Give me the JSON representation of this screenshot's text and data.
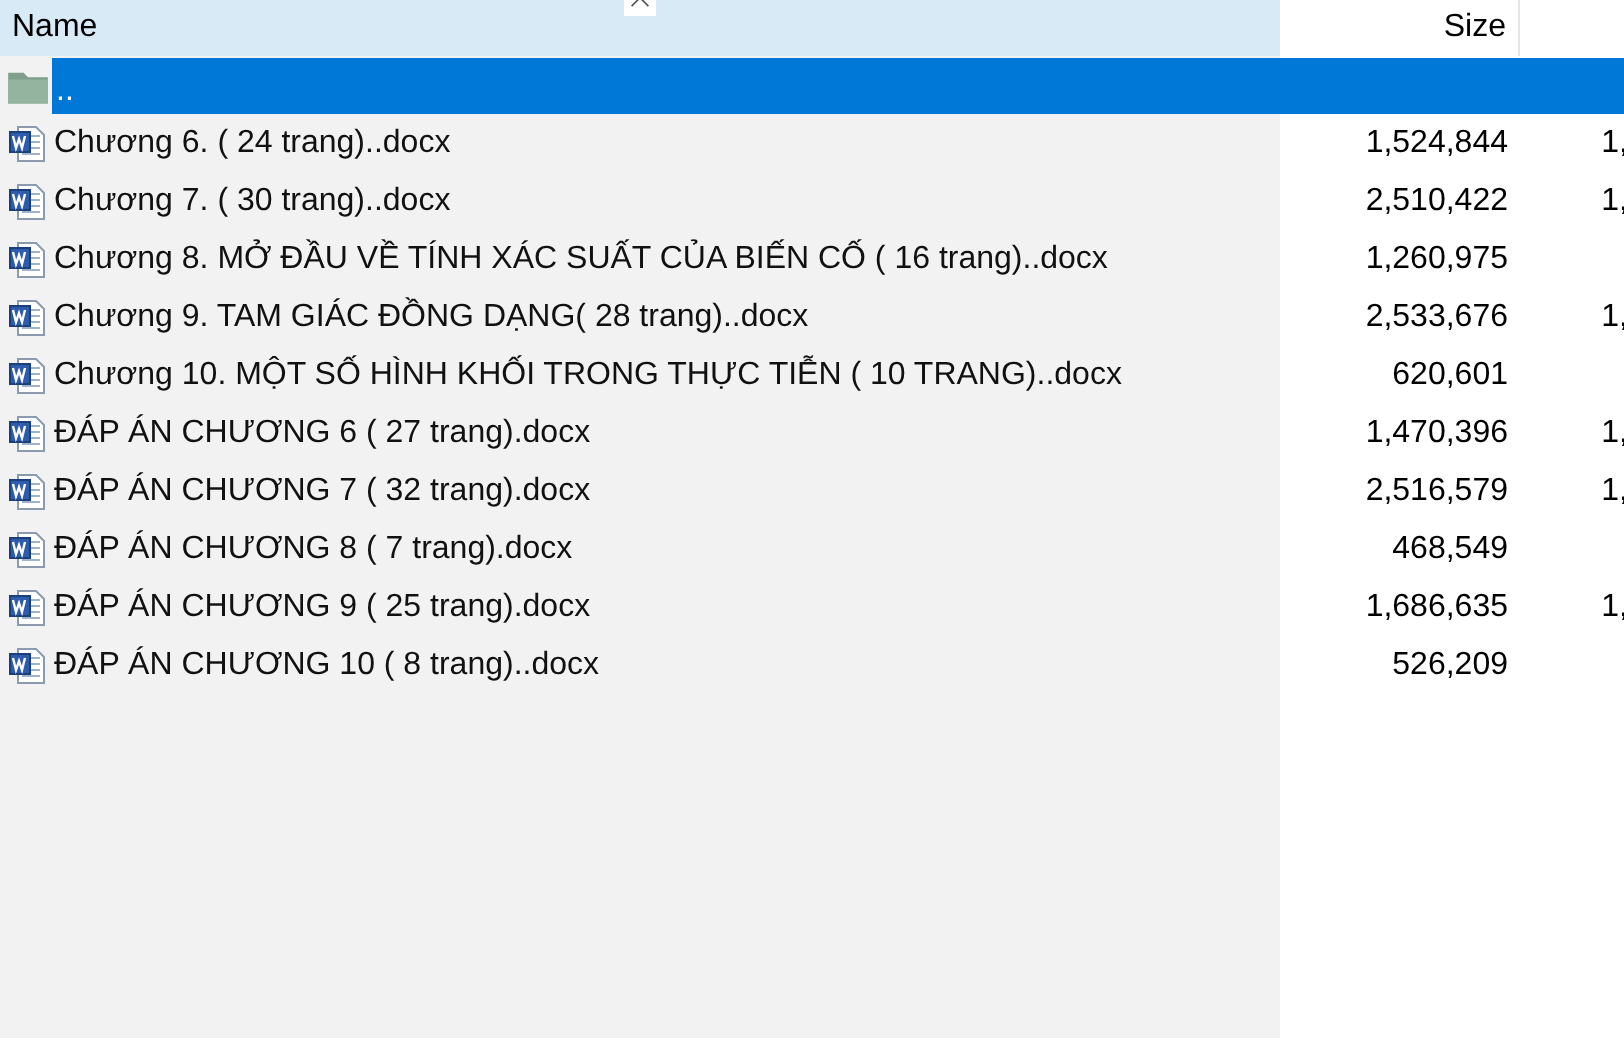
{
  "columns": [
    {
      "label": "Name",
      "sorted": true
    },
    {
      "label": "Size",
      "sorted": false
    }
  ],
  "parent_row": {
    "name": "..",
    "selected": true
  },
  "files": [
    {
      "kind": "word",
      "name": "Chương 6. ( 24 trang)..docx",
      "size": "1,524,844",
      "column_3": "1,"
    },
    {
      "kind": "word",
      "name": "Chương 7. ( 30 trang)..docx",
      "size": "2,510,422",
      "column_3": "1,"
    },
    {
      "kind": "word",
      "name": "Chương 8. MỞ ĐẦU VỀ TÍNH XÁC SUẤT CỦA BIẾN CỐ ( 16 trang)..docx",
      "size": "1,260,975"
    },
    {
      "kind": "word",
      "name": "Chương 9. TAM GIÁC ĐỒNG DẠNG( 28 trang)..docx",
      "size": "2,533,676",
      "column_3": "1,"
    },
    {
      "kind": "word",
      "name": "Chương 10. MỘT SỐ HÌNH KHỐI TRONG THỰC TIỄN ( 10 TRANG)..docx",
      "size": "620,601"
    },
    {
      "kind": "word",
      "name": "ĐÁP ÁN CHƯƠNG 6 ( 27 trang).docx",
      "size": "1,470,396",
      "column_3": "1,"
    },
    {
      "kind": "word",
      "name": "ĐÁP ÁN CHƯƠNG 7 ( 32 trang).docx",
      "size": "2,516,579",
      "column_3": "1,"
    },
    {
      "kind": "word",
      "name": "ĐÁP ÁN CHƯƠNG 8 ( 7 trang).docx",
      "size": "468,549"
    },
    {
      "kind": "word",
      "name": "ĐÁP ÁN CHƯƠNG 9 ( 25 trang).docx",
      "size": "1,686,635",
      "column_3": "1,"
    },
    {
      "kind": "word",
      "name": "ĐÁP ÁN CHƯƠNG 10 ( 8 trang)..docx",
      "size": "526,209"
    }
  ]
}
